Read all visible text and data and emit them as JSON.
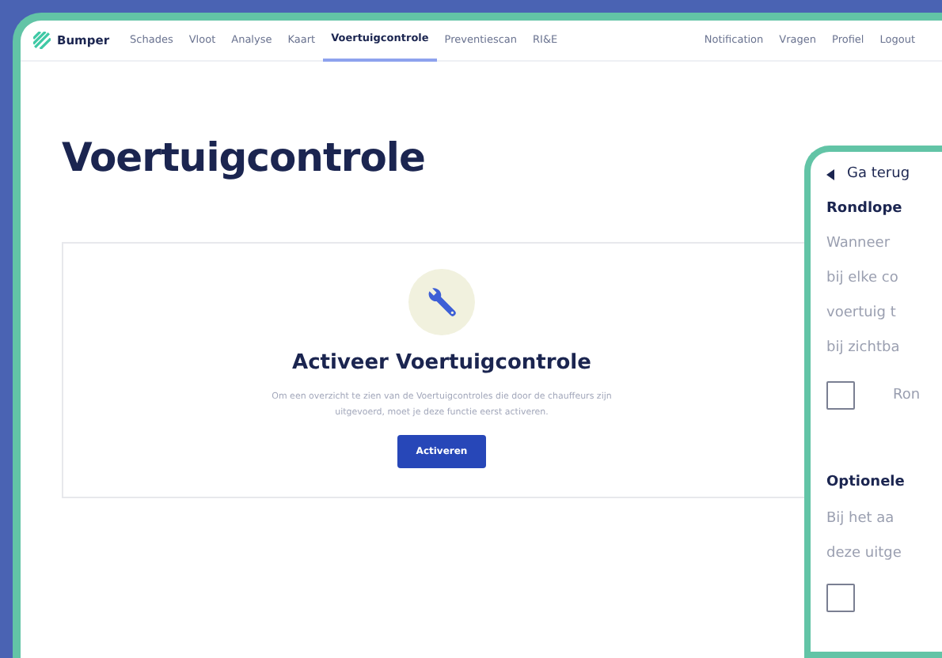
{
  "brand": "Bumper",
  "nav": [
    {
      "label": "Schades",
      "selected": false
    },
    {
      "label": "Vloot",
      "selected": false
    },
    {
      "label": "Analyse",
      "selected": false
    },
    {
      "label": "Kaart",
      "selected": false
    },
    {
      "label": "Voertuigcontrole",
      "selected": true
    },
    {
      "label": "Preventiescan",
      "selected": false
    },
    {
      "label": "RI&E",
      "selected": false
    }
  ],
  "nav_right": [
    "Notification",
    "Vragen",
    "Profiel",
    "Logout"
  ],
  "page_title": "Voertuigcontrole",
  "card": {
    "title": "Activeer Voertuigcontrole",
    "text": "Om een overzicht te zien van de Voertuigcontroles die door de chauffeurs zijn uitgevoerd, moet je deze functie eerst activeren.",
    "button": "Activeren"
  },
  "panel": {
    "back": "Ga terug",
    "sections": [
      {
        "heading": "Rondlope",
        "lines": [
          "Wanneer",
          "bij elke co",
          "voertuig t",
          "bij zichtba"
        ],
        "option": {
          "label": "Ron",
          "checked": false
        }
      },
      {
        "heading": "Optionele",
        "lines": [
          "Bij het aa",
          "deze uitge"
        ],
        "option": {
          "checked": false
        }
      }
    ]
  }
}
